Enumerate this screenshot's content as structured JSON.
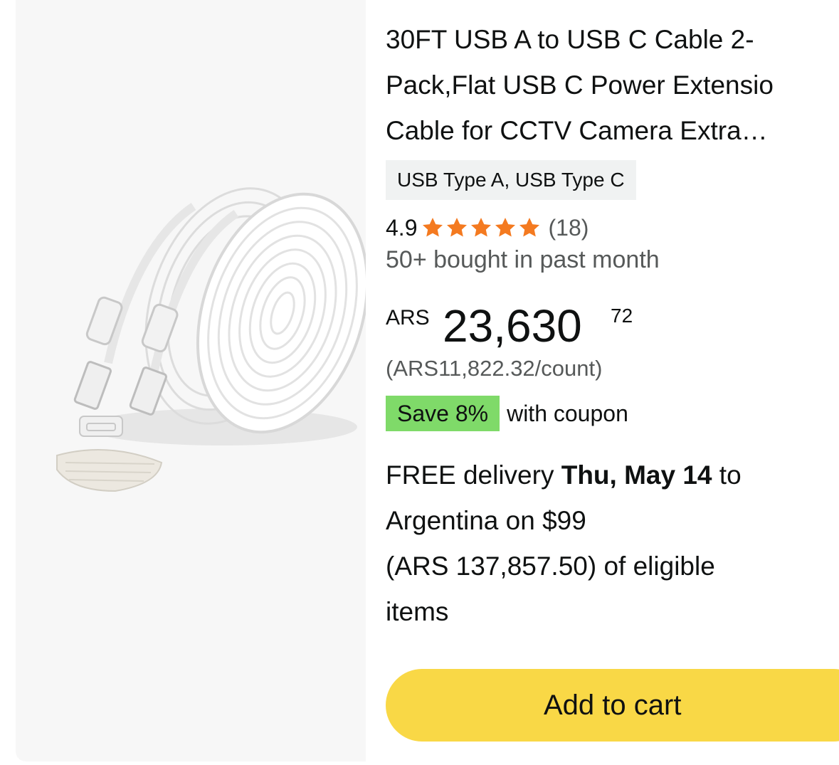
{
  "product": {
    "title_lines": [
      "30FT USB A to USB C Cable 2-",
      "Pack,Flat USB C Power Extensio",
      "Cable for CCTV Camera Extra…"
    ],
    "variant": "USB Type A, USB Type C",
    "rating": {
      "value": "4.9",
      "stars": 5,
      "count": "(18)"
    },
    "bought": "50+ bought in past month",
    "price": {
      "currency": "ARS",
      "whole": "23,630",
      "fraction": "72"
    },
    "unit_price": "(ARS11,822.32/count)",
    "coupon": {
      "badge": "Save 8%",
      "text": "with coupon"
    },
    "delivery": {
      "prefix": "FREE delivery ",
      "date": "Thu, May 14",
      "line1_suffix": " to",
      "line2": "Argentina on $99",
      "line3": "(ARS 137,857.50) of eligible",
      "line4": "items"
    },
    "add_to_cart_label": "Add to cart"
  },
  "colors": {
    "star": "#f47a20",
    "coupon_bg": "#7fda69",
    "button_bg": "#f9d846",
    "chip_bg": "#f0f2f2",
    "image_bg": "#f7f7f7"
  },
  "icons": {
    "star": "star-icon"
  }
}
